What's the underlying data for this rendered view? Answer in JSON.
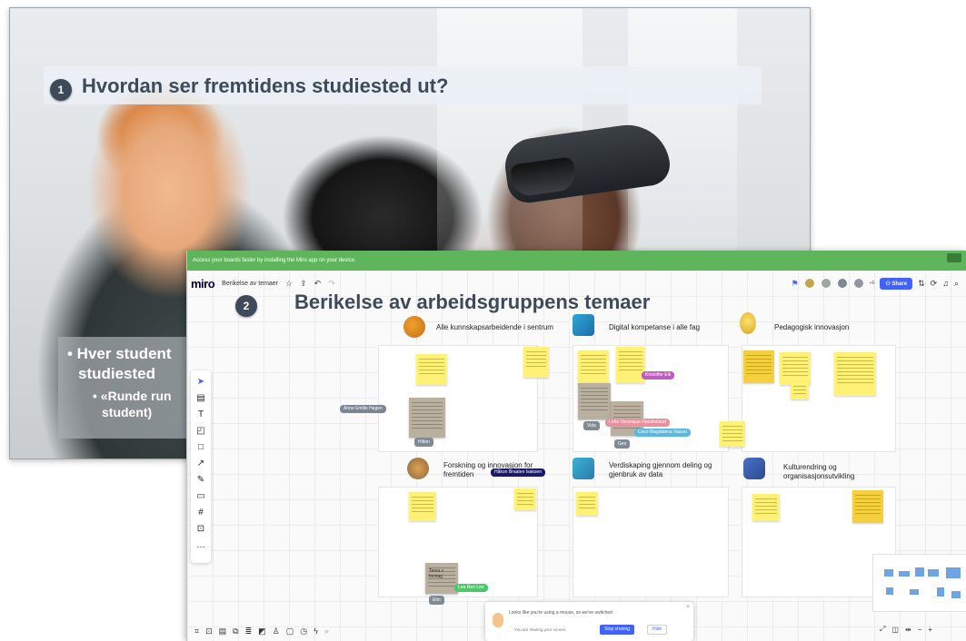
{
  "slide1": {
    "number": "1",
    "title": "Hvordan ser fremtidens studiested ut?",
    "bullet1": "• Hver student",
    "bullet1_cont": "studiested",
    "bullet2": "• «Runde run",
    "bullet2_cont": "student)"
  },
  "slide2": {
    "number": "2",
    "title": "Berikelse av arbeidsgruppens temaer",
    "banner": "Access your boards faster by installing the Miro app on your device.",
    "miro": {
      "logo": "miro",
      "board_name": "Berikelse av temaer",
      "share_label": "Share",
      "avatars_more": "+6",
      "frames": [
        {
          "title": "Alle kunnskapsarbeidende i sentrum"
        },
        {
          "title": "Digital kompetanse i alle fag"
        },
        {
          "title": "Pedagogisk innovasjon"
        },
        {
          "title": "Forskning og innovasjon for fremtiden"
        },
        {
          "title": "Verdiskaping gjennom deling og gjenbruk av data"
        },
        {
          "title": "Kulturendring og organisasjonsutvikling"
        }
      ],
      "name_chips": [
        "Hilton",
        "Vida",
        "Geo",
        "Elm"
      ],
      "cursors": {
        "anne": "Anne Emilie Hagen",
        "kristoffer": "Kristoffer Eik",
        "lotte": "Lotte Veronique Hauskeland",
        "cece": "Cece Magdalena Vassel",
        "hakon": "Håkon Braaten Isaksen",
        "lea": "Lea Ren Lee"
      },
      "photo_note_text": "Tema x\nforslag",
      "toast": {
        "text": "Looks like you're using a mouse, so we've switched",
        "sub": "You are sharing your screen.",
        "stop_label": "Stop sharing",
        "hide_label": "Hide"
      }
    }
  },
  "colors": {
    "title_text": "#3e4a5a",
    "banner_green": "#5fb55b",
    "miro_blue": "#4262ff",
    "sticky_yellow": "#fff176"
  }
}
